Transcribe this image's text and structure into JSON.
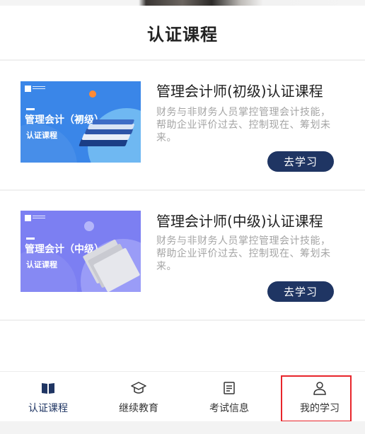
{
  "header": {
    "title": "认证课程"
  },
  "courses": [
    {
      "title": "管理会计师(初级)认证课程",
      "description": "财务与非财务人员掌控管理会计技能，帮助企业评价过去、控制现在、筹划未来。",
      "button_label": "去学习",
      "thumbnail": {
        "main_text": "管理会计（初级）",
        "sub_text": "认证课程",
        "bg_color": "#3a86e8"
      }
    },
    {
      "title": "管理会计师(中级)认证课程",
      "description": "财务与非财务人员掌控管理会计技能，帮助企业评价过去、控制现在、筹划未来。",
      "button_label": "去学习",
      "thumbnail": {
        "main_text": "管理会计（中级）",
        "sub_text": "认证课程",
        "bg_color": "#7c7ff2"
      }
    }
  ],
  "tabbar": {
    "items": [
      {
        "label": "认证课程",
        "icon": "book-icon",
        "active": true
      },
      {
        "label": "继续教育",
        "icon": "graduation-cap-icon",
        "active": false
      },
      {
        "label": "考试信息",
        "icon": "document-icon",
        "active": false
      },
      {
        "label": "我的学习",
        "icon": "user-icon",
        "active": false
      }
    ]
  },
  "colors": {
    "accent": "#1f3563",
    "highlight": "#e8252b",
    "description": "#a4a4a4"
  }
}
